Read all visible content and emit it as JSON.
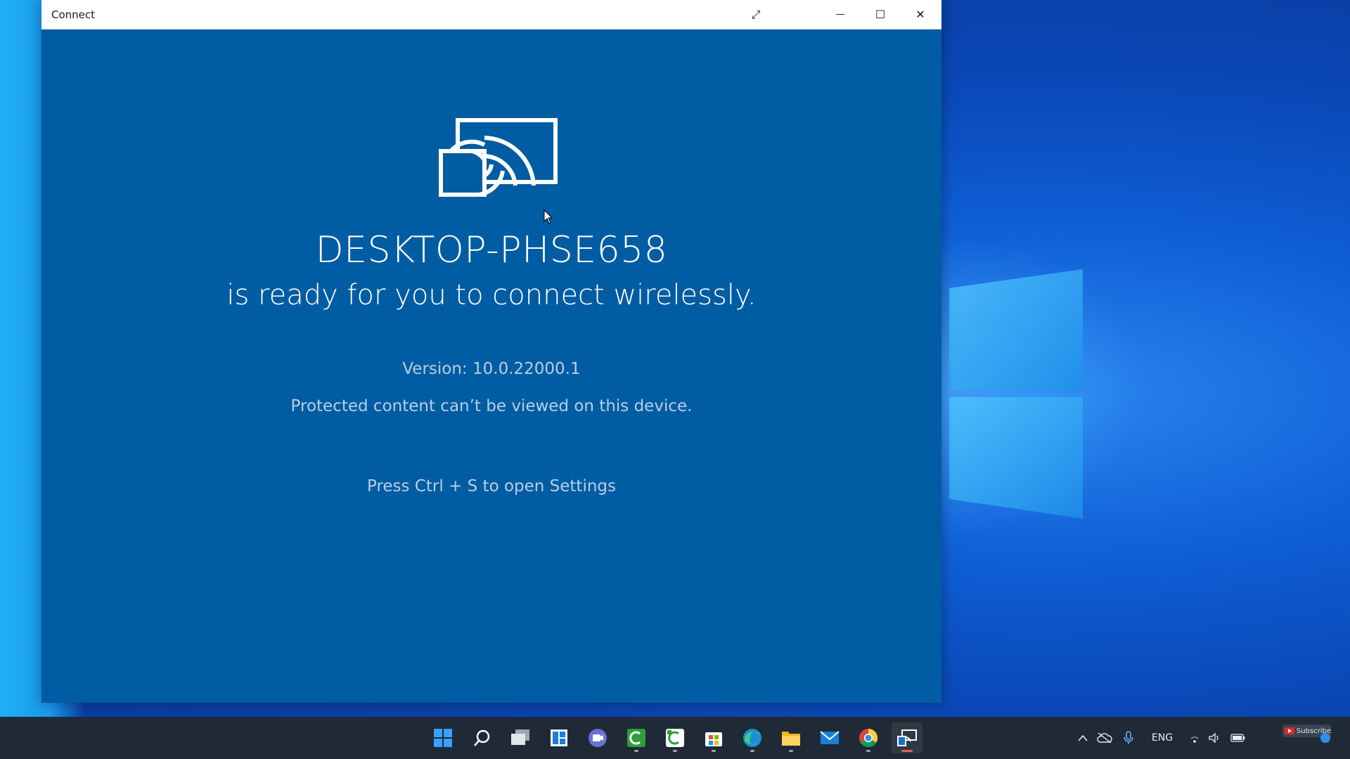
{
  "window": {
    "title": "Connect",
    "controls": {
      "expand": "⤢",
      "minimize": "—",
      "maximize": "☐",
      "close": "✕"
    }
  },
  "content": {
    "device_name": "DESKTOP-PHSE658",
    "ready_text": "is ready for you to connect wirelessly.",
    "version": "Version: 10.0.22000.1",
    "protected": "Protected content can’t be viewed on this device.",
    "press": "Press Ctrl + S to open Settings"
  },
  "taskbar": {
    "apps": [
      "start-icon",
      "search-icon",
      "task-view-icon",
      "widgets-icon",
      "teams-chat-icon",
      "camtasia-icon",
      "camtasia-recorder-icon",
      "store-icon",
      "edge-icon",
      "file-explorer-icon",
      "mail-icon",
      "chrome-icon",
      "connect-app-icon"
    ],
    "tray": {
      "language": "ENG"
    },
    "subscribe_label": "Subscribe"
  },
  "colors": {
    "window_bg": "#005ca3",
    "desktop": "#0a49b8",
    "taskbar": "#1f2a36"
  }
}
